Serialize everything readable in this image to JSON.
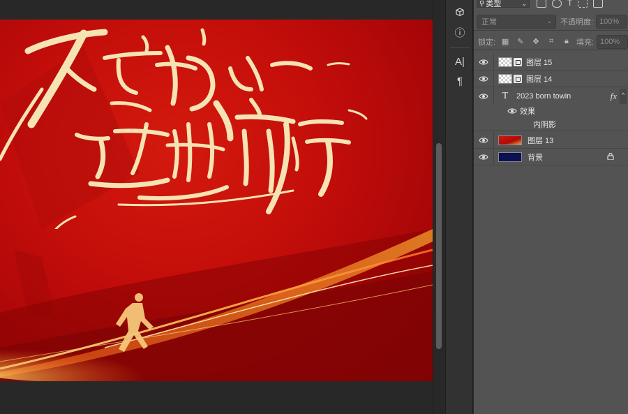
{
  "layers_panel": {
    "filter": {
      "label": "类型"
    },
    "blend_mode": "正常",
    "opacity_label": "不透明度:",
    "opacity_value": "100%",
    "lock_label": "锁定:",
    "fill_label": "填充:",
    "fill_value": "100%",
    "layers": [
      {
        "name": "图层 15",
        "kind": "smart-object",
        "visible": true
      },
      {
        "name": "图层 14",
        "kind": "smart-object",
        "visible": true
      },
      {
        "name": "2023 born  towin",
        "kind": "text",
        "visible": true,
        "has_fx": true,
        "fx_label": "fx",
        "effects_label": "效果",
        "effects": [
          "内阴影"
        ]
      },
      {
        "name": "图层 13",
        "kind": "image",
        "visible": true,
        "thumb_color": "#c0140e"
      },
      {
        "name": "背景",
        "kind": "background",
        "visible": true,
        "locked": true,
        "thumb_color": "#0b1150"
      }
    ]
  },
  "toolbar": {
    "items": [
      "3d-cube-icon",
      "info-icon",
      "character-icon",
      "paragraph-icon"
    ],
    "character_glyph": "A|",
    "paragraph_glyph": "¶",
    "info_glyph": "ⓘ"
  },
  "colors": {
    "canvas_red": "#c40e0a",
    "gold": "#f4d9a4",
    "panel_bg": "#535353",
    "app_bg": "#282828"
  }
}
